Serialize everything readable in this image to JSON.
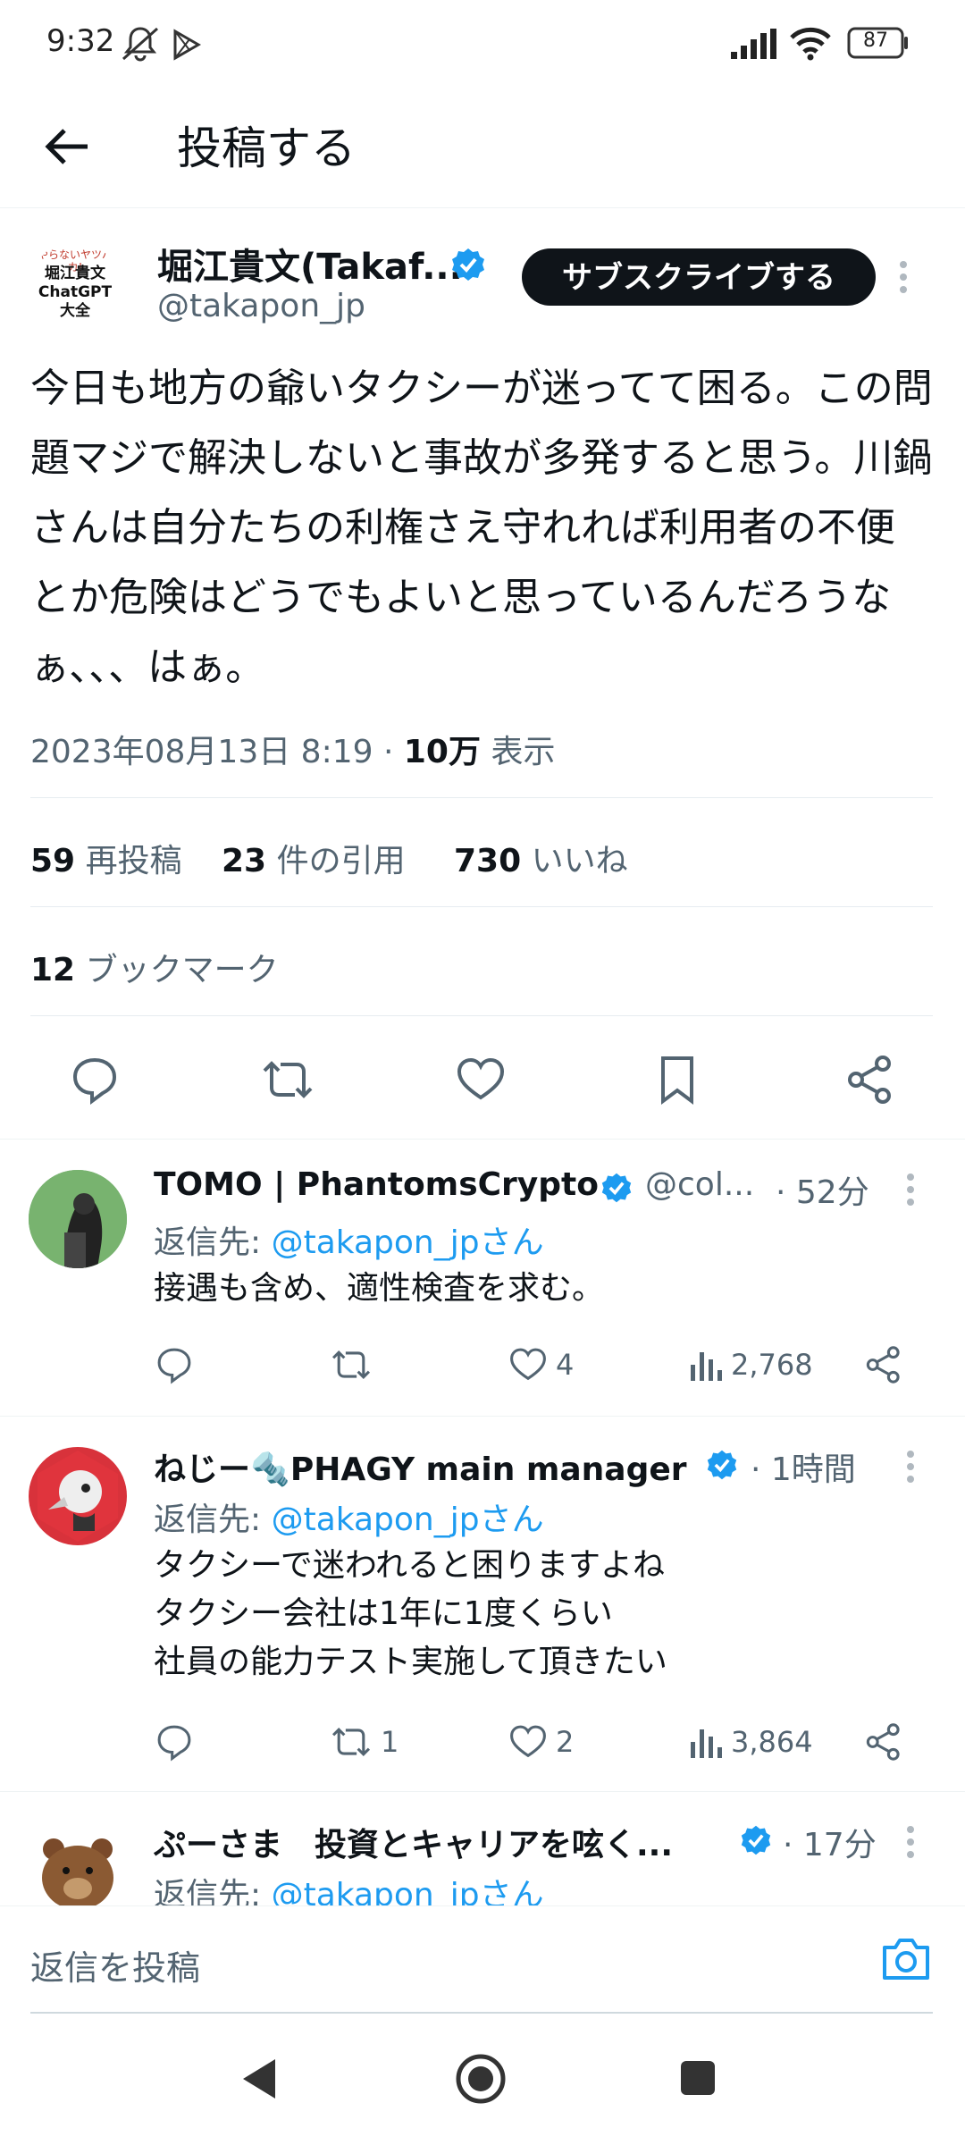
{
  "status": {
    "time": "9:32",
    "battery": "87"
  },
  "header": {
    "title": "投稿する"
  },
  "tweet": {
    "avatar_text": [
      "やらないヤツバカ!",
      "堀江貴文",
      "ChatGPT",
      "大全"
    ],
    "author_name": "堀江貴文(Takaf...",
    "handle": "@takapon_jp",
    "subscribe_label": "サブスクライブする",
    "text": "今日も地方の爺いタクシーが迷ってて困る。この問題マジで解決しないと事故が多発すると思う。川鍋さんは自分たちの利権さえ守れれば利用者の不便とか危険はどうでもよいと思っているんだろうなぁ、、、はぁ。",
    "datetime": "2023年08月13日 8:19",
    "views_count": "10万",
    "views_label": "表示",
    "reposts_count": "59",
    "reposts_label": "再投稿",
    "quotes_count": "23",
    "quotes_label": "件の引用",
    "likes_count": "730",
    "likes_label": "いいね",
    "bookmarks_count": "12",
    "bookmarks_label": "ブックマーク"
  },
  "replies": [
    {
      "name": "TOMO | PhantomsCrypto",
      "handle": "@col...",
      "time": "· 52分",
      "reply_prefix": "返信先: ",
      "reply_to": "@takapon_jpさん",
      "lines": [
        "接遇も含め、適性検査を求む。"
      ],
      "retweets": "",
      "likes": "4",
      "views": "2,768"
    },
    {
      "name": "ねじー🔩PHAGY main manager",
      "handle": "",
      "time": "· 1時間",
      "reply_prefix": "返信先: ",
      "reply_to": "@takapon_jpさん",
      "lines": [
        "タクシーで迷われると困りますよね",
        "タクシー会社は1年に1度くらい",
        "社員の能力テスト実施して頂きたい"
      ],
      "retweets": "1",
      "likes": "2",
      "views": "3,864"
    },
    {
      "name": "ぷーさま　投資とキャリアを呟く...",
      "handle": "",
      "time": "· 17分",
      "reply_prefix": "返信先: ",
      "reply_to": "@takapon_jpさん"
    }
  ],
  "compose": {
    "placeholder": "返信を投稿"
  },
  "colors": {
    "accent": "#1d9bf0",
    "text": "#0f1419",
    "muted": "#536471"
  },
  "icons": [
    "back-arrow-icon",
    "verified-badge-icon",
    "more-icon",
    "reply-icon",
    "retweet-icon",
    "like-icon",
    "bookmark-icon",
    "share-icon",
    "views-icon",
    "camera-icon"
  ]
}
